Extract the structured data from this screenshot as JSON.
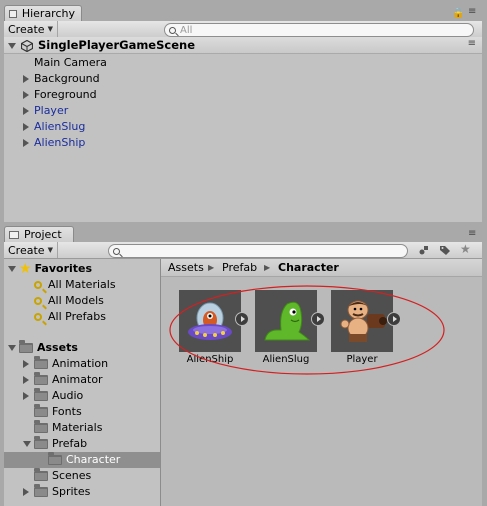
{
  "hierarchy": {
    "tab_label": "Hierarchy",
    "create_label": "Create",
    "search_placeholder": "ⓆAll",
    "search_text": "All",
    "scene_name": "SinglePlayerGameScene",
    "items": [
      {
        "label": "Main Camera",
        "expandable": false,
        "prefab": false
      },
      {
        "label": "Background",
        "expandable": true,
        "prefab": false
      },
      {
        "label": "Foreground",
        "expandable": true,
        "prefab": false
      },
      {
        "label": "Player",
        "expandable": true,
        "prefab": true
      },
      {
        "label": "AlienSlug",
        "expandable": true,
        "prefab": true
      },
      {
        "label": "AlienShip",
        "expandable": true,
        "prefab": true
      }
    ]
  },
  "project": {
    "tab_label": "Project",
    "create_label": "Create",
    "favorites_label": "Favorites",
    "favorites": [
      "All Materials",
      "All Models",
      "All Prefabs"
    ],
    "assets_label": "Assets",
    "folders": [
      {
        "label": "Animation",
        "expandable": true
      },
      {
        "label": "Animator",
        "expandable": true
      },
      {
        "label": "Audio",
        "expandable": true
      },
      {
        "label": "Fonts",
        "expandable": false
      },
      {
        "label": "Materials",
        "expandable": false
      },
      {
        "label": "Prefab",
        "expandable": true,
        "expanded": true
      },
      {
        "label": "Character",
        "expandable": false,
        "selected": true,
        "child": true
      },
      {
        "label": "Scenes",
        "expandable": false
      },
      {
        "label": "Sprites",
        "expandable": true
      }
    ],
    "breadcrumb": [
      "Assets",
      "Prefab",
      "Character"
    ],
    "assets": [
      {
        "label": "AlienShip"
      },
      {
        "label": "AlienSlug"
      },
      {
        "label": "Player"
      }
    ]
  },
  "colors": {
    "prefab_text": "#1a2d9c",
    "highlight_ellipse": "#d42020",
    "selection": "#8f8f8f"
  }
}
